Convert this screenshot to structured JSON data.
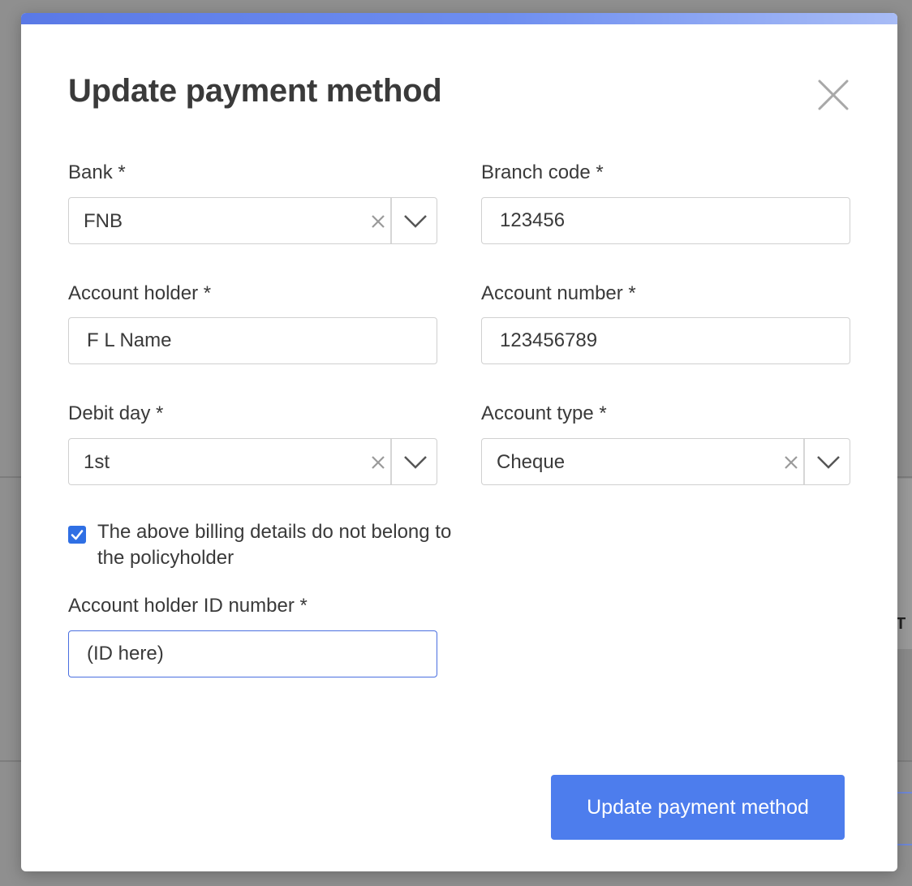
{
  "modal": {
    "title": "Update payment method",
    "submit_label": "Update payment method"
  },
  "fields": {
    "bank": {
      "label": "Bank *",
      "value": "FNB"
    },
    "branch_code": {
      "label": "Branch code *",
      "value": "123456"
    },
    "account_holder": {
      "label": "Account holder *",
      "value": "F L Name"
    },
    "account_number": {
      "label": "Account number *",
      "value": "123456789"
    },
    "debit_day": {
      "label": "Debit day *",
      "value": "1st"
    },
    "account_type": {
      "label": "Account type *",
      "value": "Cheque"
    },
    "not_policyholder": {
      "label": "The above billing details do not belong to the policyholder",
      "checked": true
    },
    "account_holder_id": {
      "label": "Account holder ID number *",
      "value": "(ID here)"
    }
  },
  "background": {
    "partial_text": "T"
  },
  "colors": {
    "accent": "#4d7ded",
    "checkbox": "#2f6fe4",
    "focus_border": "#4a6fe0",
    "title_text": "#3a3a3a",
    "icon_gray": "#9a9a9a"
  }
}
